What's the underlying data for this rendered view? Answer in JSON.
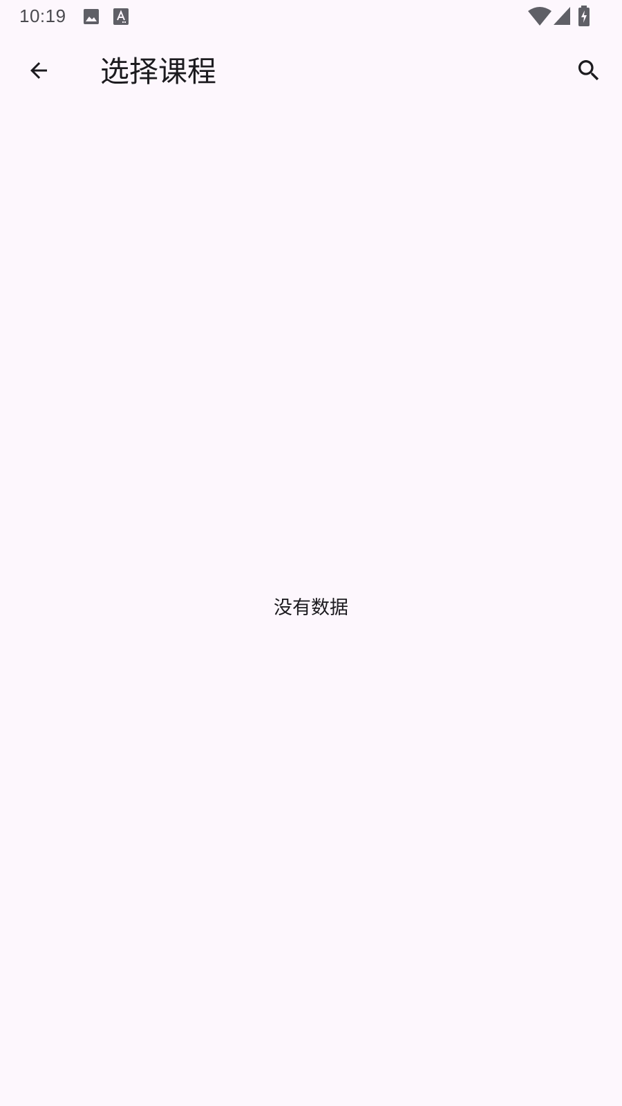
{
  "status_bar": {
    "time": "10:19",
    "icons": [
      "image-icon",
      "text-a-icon",
      "wifi-icon",
      "cell-signal-icon",
      "battery-charging-icon"
    ],
    "icon_color": "#5F5F66"
  },
  "app_bar": {
    "back_icon": "arrow-back-icon",
    "title": "选择课程",
    "search_icon": "search-icon"
  },
  "content": {
    "empty_message": "没有数据"
  },
  "colors": {
    "background": "#FDF7FD",
    "on_surface": "#1C1B1F"
  }
}
